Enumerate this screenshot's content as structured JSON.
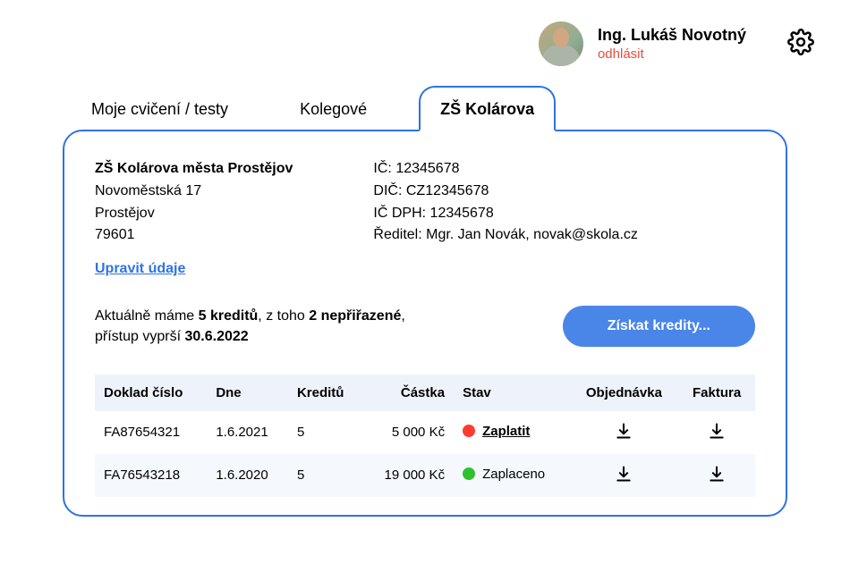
{
  "user": {
    "name": "Ing. Lukáš Novotný",
    "logout_label": "odhlásit"
  },
  "tabs": {
    "exercises": "Moje cvičení / testy",
    "colleagues": "Kolegové",
    "school": "ZŠ Kolárova"
  },
  "school": {
    "name": "ZŠ Kolárova města Prostějov",
    "address_line1": "Novoměstská 17",
    "address_line2": "Prostějov",
    "postal": "79601",
    "ic": "IČ: 12345678",
    "dic": "DIČ: CZ12345678",
    "ic_dph": "IČ DPH: 12345678",
    "director": "Ředitel: Mgr. Jan Novák, novak@skola.cz"
  },
  "edit_label": "Upravit údaje",
  "credits": {
    "prefix": "Aktuálně máme ",
    "count": "5 kreditů",
    "mid": ", z toho ",
    "unassigned": "2 nepřiřazené",
    "line2_prefix": "přístup vyprší ",
    "expiry": "30.6.2022",
    "button": "Získat kredity..."
  },
  "table": {
    "headers": {
      "doc": "Doklad číslo",
      "date": "Dne",
      "credits": "Kreditů",
      "amount": "Částka",
      "status": "Stav",
      "order": "Objednávka",
      "invoice": "Faktura"
    },
    "rows": [
      {
        "doc": "FA87654321",
        "date": "1.6.2021",
        "credits": "5",
        "amount": "5 000 Kč",
        "status_color": "red",
        "status_label": "Zaplatit",
        "status_link": true
      },
      {
        "doc": "FA76543218",
        "date": "1.6.2020",
        "credits": "5",
        "amount": "19 000 Kč",
        "status_color": "green",
        "status_label": "Zaplaceno",
        "status_link": false
      }
    ]
  }
}
